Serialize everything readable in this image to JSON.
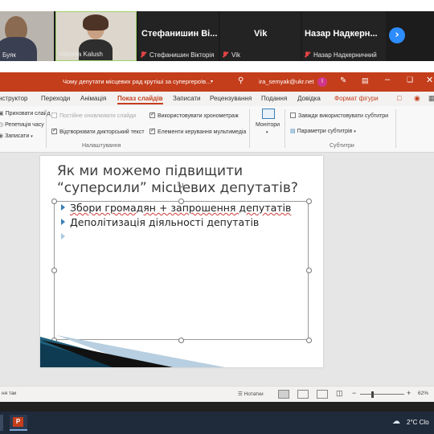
{
  "zoom": {
    "tiles": [
      {
        "name": "Буяк"
      },
      {
        "name": "Viktoriia Kalush"
      },
      {
        "big_name": "Стефанишин Ві...",
        "small_name": "Стефанишин Вікторія"
      },
      {
        "big_name": "Vik",
        "small_name": "Vik"
      },
      {
        "big_name": "Назар Надкерн...",
        "small_name": "Назар Надкерничний"
      }
    ],
    "next_icon": "chevron-right-icon"
  },
  "titlebar": {
    "document_title": "Чому депутати місцевих рад крутіші за супергероїв...",
    "user_email": "ira_semyak@ukr.net",
    "user_initial": "I"
  },
  "ribbon": {
    "tabs": [
      "нструктор",
      "Переходи",
      "Анімація",
      "Показ слайдів",
      "Записати",
      "Рецензування",
      "Подання",
      "Довідка",
      "Формат фігури"
    ],
    "active_tab": "Показ слайдів",
    "items": {
      "hide_slide": "Приховати слайд",
      "rehearse": "Репетиція часу",
      "record": "Записати",
      "keep_updated": "Постійне оновлювати слайди",
      "play_narrations": "Відтворювати дикторський текст",
      "use_timings": "Використовувати хронометраж",
      "show_media_controls": "Елементи керування мультимедіа",
      "monitors": "Монітори",
      "always_subtitles": "Завжди використовувати субтитри",
      "subtitle_settings": "Параметри субтитрів"
    },
    "group_setup": "Налаштування",
    "group_subtitles": "Субтитри"
  },
  "slide": {
    "title_line1": "Як ми можемо підвищити",
    "title_line2": "“суперсили” місцевих депутатів?",
    "bullets": [
      "Збори громадян + запрошення депутатів",
      "Деполітизація діяльності депутатів"
    ]
  },
  "statusbar": {
    "left_text": "ня так",
    "notes_label": "Нотатки",
    "zoom_level": "62%"
  },
  "taskbar": {
    "weather": "2°C  Clo"
  },
  "colors": {
    "ppt_accent": "#c43e1c",
    "zoom_blue": "#2d8cff",
    "bullet_blue": "#3b7fb6"
  }
}
